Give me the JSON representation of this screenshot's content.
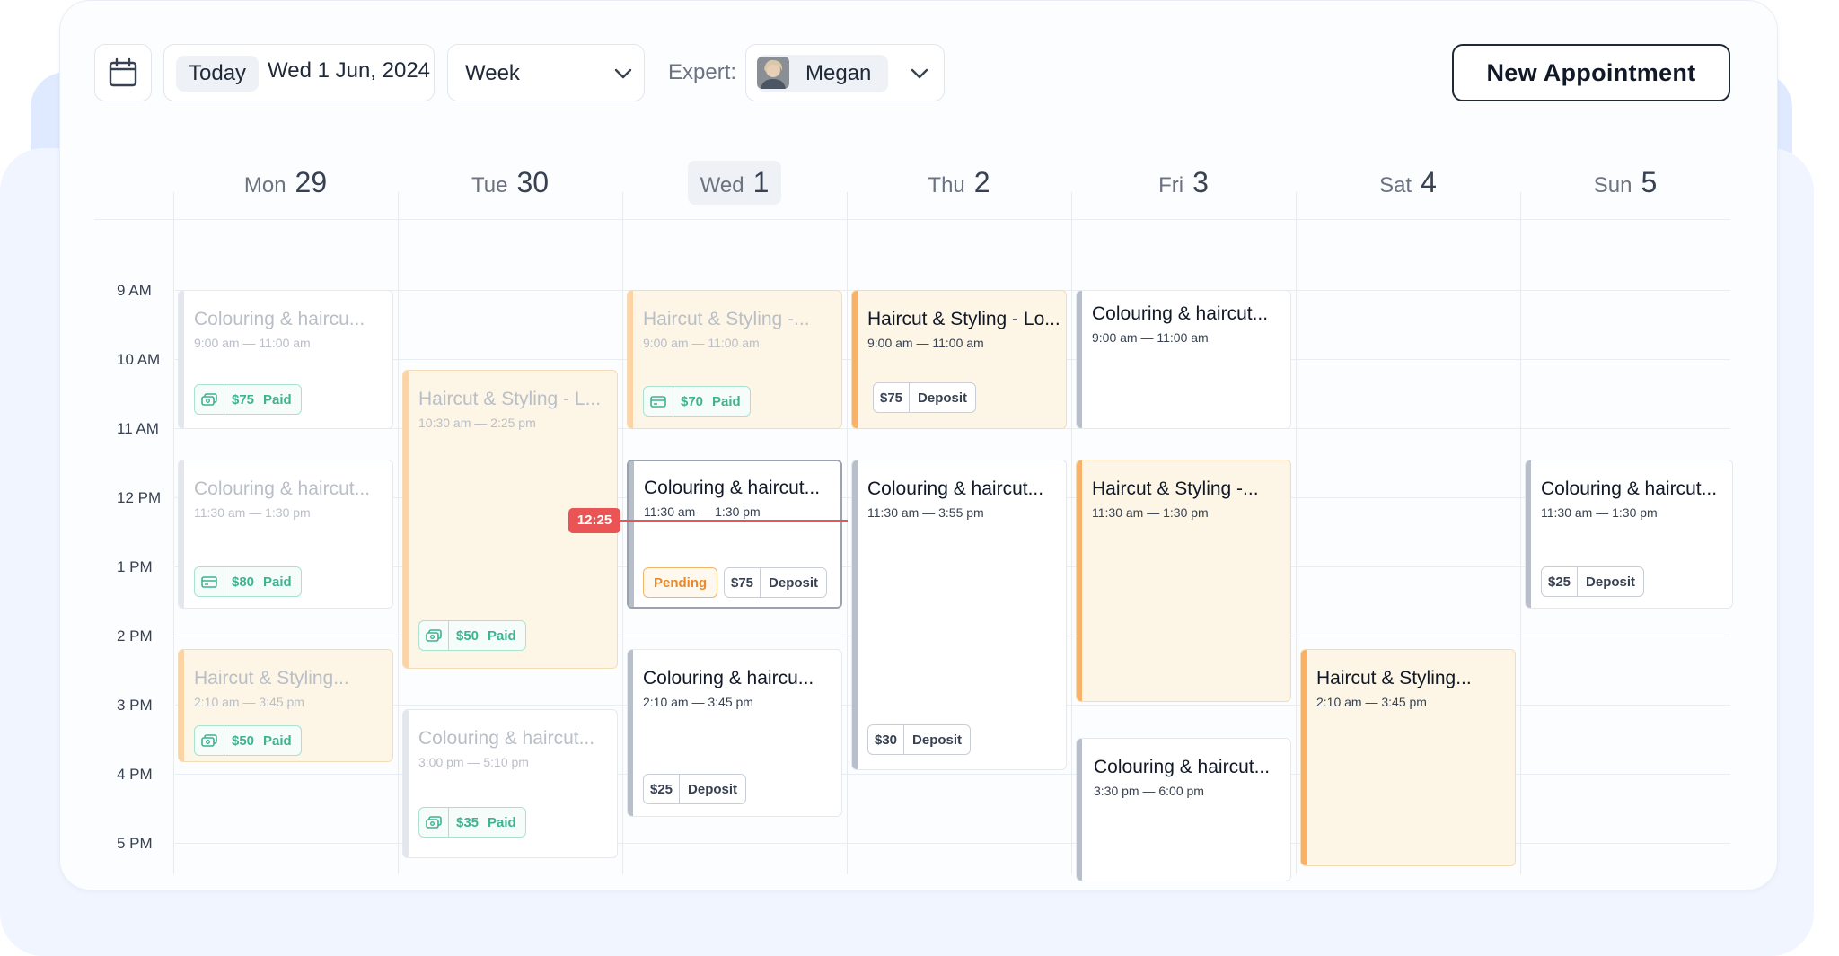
{
  "toolbar": {
    "today_label": "Today",
    "current_date": "Wed 1 Jun, 2024",
    "view_select": "Week",
    "expert_label": "Expert:",
    "expert_name": "Megan",
    "new_appointment_label": "New Appointment"
  },
  "days": [
    {
      "name": "Mon",
      "num": "29"
    },
    {
      "name": "Tue",
      "num": "30"
    },
    {
      "name": "Wed",
      "num": "1"
    },
    {
      "name": "Thu",
      "num": "2"
    },
    {
      "name": "Fri",
      "num": "3"
    },
    {
      "name": "Sat",
      "num": "4"
    },
    {
      "name": "Sun",
      "num": "5"
    }
  ],
  "time_labels": [
    "9 AM",
    "10 AM",
    "11 AM",
    "12 PM",
    "1 PM",
    "2 PM",
    "3 PM",
    "4 PM",
    "5 PM"
  ],
  "current_time": "12:25",
  "events": [
    {
      "title": "Colouring & haircu...",
      "time": "9:00 am — 11:00 am",
      "amount": "$75",
      "status": "Paid"
    },
    {
      "title": "Colouring & haircut...",
      "time": "11:30 am — 1:30 pm",
      "amount": "$80",
      "status": "Paid"
    },
    {
      "title": "Haircut & Styling...",
      "time": "2:10 am — 3:45 pm",
      "amount": "$50",
      "status": "Paid"
    },
    {
      "title": "Haircut & Styling - L...",
      "time": "10:30 am — 2:25 pm",
      "amount": "$50",
      "status": "Paid"
    },
    {
      "title": "Colouring & haircut...",
      "time": "3:00 pm — 5:10 pm",
      "amount": "$35",
      "status": "Paid"
    },
    {
      "title": "Haircut & Styling -...",
      "time": "9:00 am — 11:00 am",
      "amount": "$70",
      "status": "Paid"
    },
    {
      "title": "Colouring & haircut...",
      "time": "11:30 am — 1:30 pm",
      "pending": "Pending",
      "amount": "$75",
      "status": "Deposit"
    },
    {
      "title": "Colouring & haircu...",
      "time": "2:10 am — 3:45 pm",
      "amount": "$25",
      "status": "Deposit"
    },
    {
      "title": "Haircut & Styling - Lo...",
      "time": "9:00 am — 11:00 am",
      "amount": "$75",
      "status": "Deposit"
    },
    {
      "title": "Colouring & haircut...",
      "time": "11:30 am — 3:55 pm",
      "amount": "$30",
      "status": "Deposit"
    },
    {
      "title": "Colouring & haircut...",
      "time": "9:00 am — 11:00 am"
    },
    {
      "title": "Haircut & Styling -...",
      "time": "11:30 am — 1:30 pm"
    },
    {
      "title": "Colouring & haircut...",
      "time": "3:30 pm — 6:00 pm"
    },
    {
      "title": "Haircut & Styling...",
      "time": "2:10 am — 3:45 pm"
    },
    {
      "title": "Colouring & haircut...",
      "time": "11:30 am — 1:30 pm",
      "amount": "$25",
      "status": "Deposit"
    }
  ],
  "colors": {
    "accent_orange": "#f7b267",
    "neutral_bar": "#b8bfca",
    "paid_green": "#3fb28f",
    "now_red": "#ea5455"
  }
}
